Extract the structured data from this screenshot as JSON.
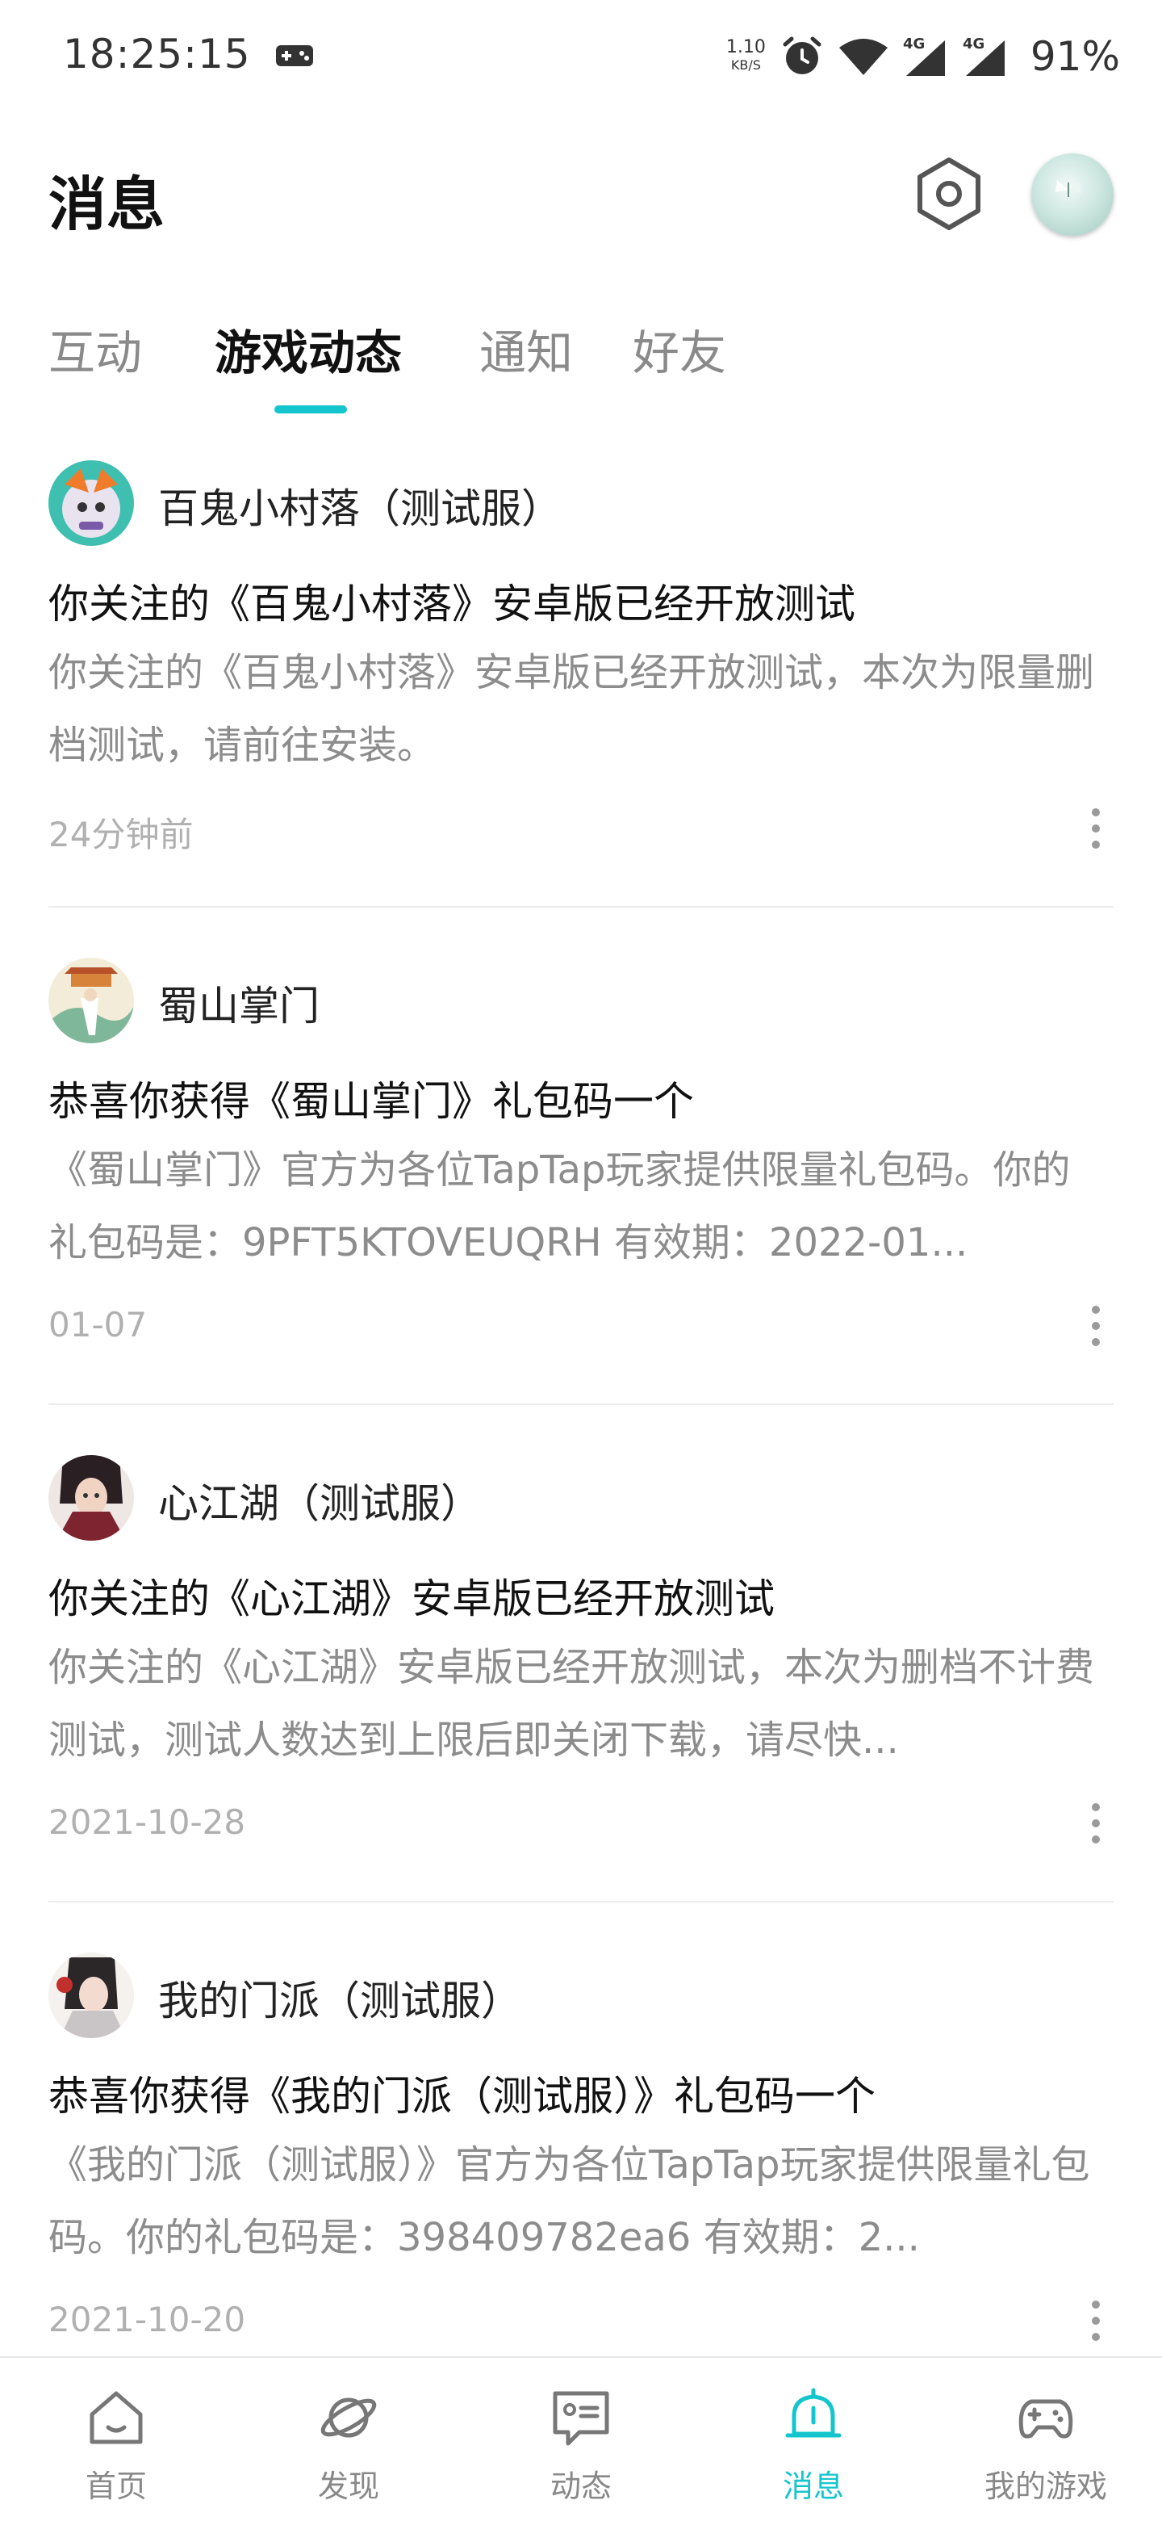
{
  "status_bar": {
    "time": "18:25:15",
    "net_speed": "1.10",
    "net_unit": "KB/S",
    "battery": "91%",
    "icons": [
      "gamepad-icon",
      "alarm-icon",
      "wifi-icon",
      "signal-4g-icon",
      "signal-4g-icon"
    ]
  },
  "header": {
    "title": "消息",
    "settings_icon": "hexagon-settings-icon",
    "avatar_icon": "user-avatar"
  },
  "tabs": [
    {
      "label": "互动",
      "active": false
    },
    {
      "label": "游戏动态",
      "active": true
    },
    {
      "label": "通知",
      "active": false
    },
    {
      "label": "好友",
      "active": false
    }
  ],
  "colors": {
    "accent": "#15c5ce",
    "secondary_text": "#8c8c8c",
    "time_text": "#b0b0b0"
  },
  "feed": [
    {
      "game_name": "百鬼小村落（测试服）",
      "title": "你关注的《百鬼小村落》安卓版已经开放测试",
      "body": "你关注的《百鬼小村落》安卓版已经开放测试，本次为限量删档测试，请前往安装。",
      "time": "24分钟前"
    },
    {
      "game_name": "蜀山掌门",
      "title": "恭喜你获得《蜀山掌门》礼包码一个",
      "body": "《蜀山掌门》官方为各位TapTap玩家提供限量礼包码。你的礼包码是：9PFT5KTOVEUQRH 有效期：2022-01...",
      "time": "01-07"
    },
    {
      "game_name": "心江湖（测试服）",
      "title": "你关注的《心江湖》安卓版已经开放测试",
      "body": "你关注的《心江湖》安卓版已经开放测试，本次为删档不计费测试，测试人数达到上限后即关闭下载，请尽快...",
      "time": "2021-10-28"
    },
    {
      "game_name": "我的门派（测试服）",
      "title": "恭喜你获得《我的门派（测试服）》礼包码一个",
      "body": "《我的门派（测试服）》官方为各位TapTap玩家提供限量礼包码。你的礼包码是：398409782ea6 有效期：2...",
      "time": "2021-10-20"
    }
  ],
  "bottom_nav": [
    {
      "label": "首页",
      "icon": "home-icon",
      "active": false
    },
    {
      "label": "发现",
      "icon": "planet-icon",
      "active": false
    },
    {
      "label": "动态",
      "icon": "chat-icon",
      "active": false
    },
    {
      "label": "消息",
      "icon": "bell-icon",
      "active": true
    },
    {
      "label": "我的游戏",
      "icon": "gamepad-icon",
      "active": false
    }
  ]
}
